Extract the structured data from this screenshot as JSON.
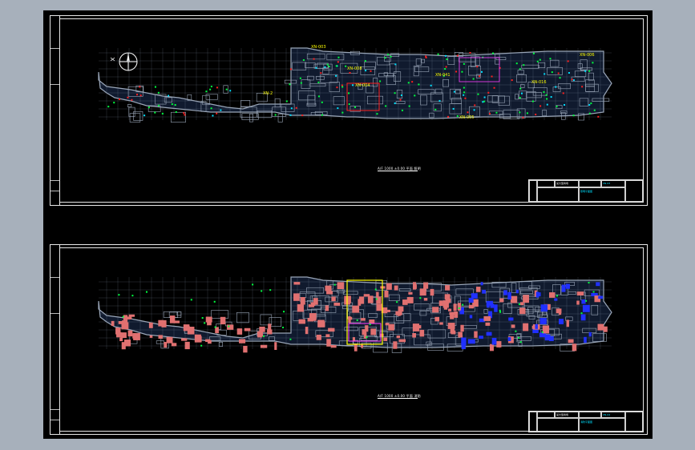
{
  "viewport_bg": "#000000",
  "sheets": [
    {
      "id": "lighting-plan",
      "caption": "A/F 1000 ±0.00 平面 照明",
      "room_labels": [
        "XN-003",
        "XN-004",
        "XN-008",
        "XN-2",
        "XN-041",
        "XN-005",
        "XN-016",
        "XN-006"
      ],
      "title_block": {
        "project": "某大型商场",
        "drawing": "照明平面图",
        "code": "XN-03"
      }
    },
    {
      "id": "fire-plan",
      "caption": "A/F 1000 ±0.00 平面 消防",
      "title_block": {
        "project": "某大型商场",
        "drawing": "消防平面图",
        "code": "XN-04"
      }
    }
  ],
  "colors": {
    "wall": "#9aa6b8",
    "grid": "#7d8aa0",
    "red": "#ff2020",
    "green": "#00ff40",
    "yellow": "#ffff00",
    "magenta": "#ff40ff",
    "pink": "#e07070",
    "blue": "#2030ff",
    "cyan": "#00e0ff"
  }
}
